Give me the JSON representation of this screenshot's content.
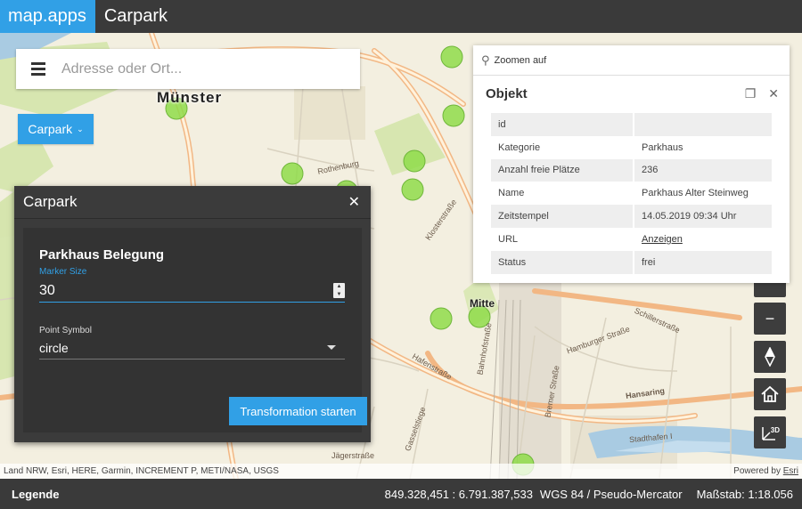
{
  "header": {
    "brand": "map.apps",
    "title": "Carpark"
  },
  "search": {
    "placeholder": "Adresse oder Ort..."
  },
  "carpark_menu": {
    "label": "Carpark"
  },
  "map": {
    "city_label": "Münster",
    "poi_label": "Mitte",
    "street_labels": [
      "Rothenburg",
      "Klosterstraße",
      "Hafenstraße",
      "Hansaring",
      "Bahnhofstraße",
      "Schillerstraße",
      "Hamburger Straße",
      "Bremer Straße",
      "Stadthafen I",
      "Jägerstraße",
      "Gasselstiege"
    ],
    "marker_color": "#8fdc4a"
  },
  "dialog": {
    "title": "Carpark",
    "heading": "Parkhaus Belegung",
    "marker_size_label": "Marker Size",
    "marker_size_value": "30",
    "point_symbol_label": "Point Symbol",
    "point_symbol_value": "circle",
    "run_button": "Transformation starten"
  },
  "popup": {
    "zoom_label": "Zoomen auf",
    "title": "Objekt",
    "rows": [
      {
        "key": "id",
        "value": ""
      },
      {
        "key": "Kategorie",
        "value": "Parkhaus"
      },
      {
        "key": "Anzahl freie Plätze",
        "value": "236"
      },
      {
        "key": "Name",
        "value": "Parkhaus Alter Steinweg"
      },
      {
        "key": "Zeitstempel",
        "value": "14.05.2019 09:34 Uhr"
      },
      {
        "key": "URL",
        "value": "Anzeigen"
      },
      {
        "key": "Status",
        "value": "frei"
      }
    ]
  },
  "controls": {
    "zoom_out": "−",
    "compass": "compass-icon",
    "home": "home-icon",
    "view3d": "3D"
  },
  "attribution": {
    "left": "Land NRW, Esri, HERE, Garmin, INCREMENT P, METI/NASA, USGS",
    "powered_by": "Powered by",
    "esri": "Esri"
  },
  "footer": {
    "legend": "Legende",
    "coordinates": "849.328,451 : 6.791.387,533",
    "crs": "WGS 84 / Pseudo-Mercator",
    "scale": "Maßstab: 1:18.056"
  },
  "colors": {
    "accent": "#31a0e6",
    "bar": "#3a3a3a"
  }
}
